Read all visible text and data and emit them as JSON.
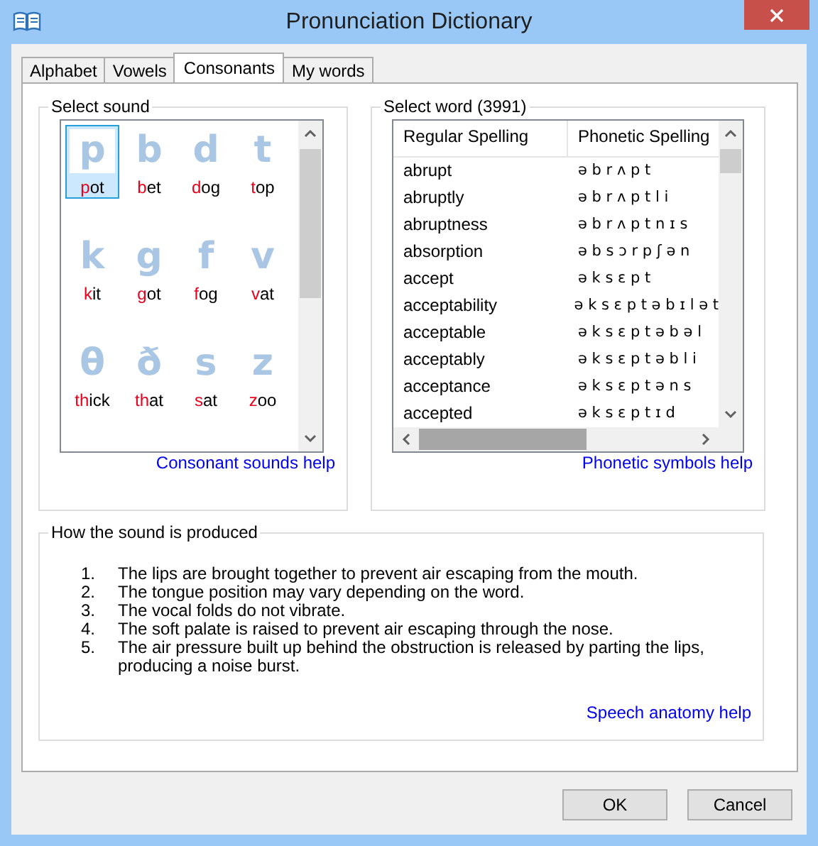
{
  "window": {
    "title": "Pronunciation Dictionary"
  },
  "tabs": [
    {
      "label": "Alphabet",
      "selected": false
    },
    {
      "label": "Vowels",
      "selected": false
    },
    {
      "label": "Consonants",
      "selected": true
    },
    {
      "label": "My words",
      "selected": false
    }
  ],
  "select_sound": {
    "title": "Select sound",
    "help_link": "Consonant sounds help",
    "sounds": [
      {
        "symbol": "p",
        "highlight": "p",
        "rest": "ot",
        "selected": true
      },
      {
        "symbol": "b",
        "highlight": "b",
        "rest": "et",
        "selected": false
      },
      {
        "symbol": "d",
        "highlight": "d",
        "rest": "og",
        "selected": false
      },
      {
        "symbol": "t",
        "highlight": "t",
        "rest": "op",
        "selected": false
      },
      {
        "symbol": "k",
        "highlight": "k",
        "rest": "it",
        "selected": false
      },
      {
        "symbol": "g",
        "highlight": "g",
        "rest": "ot",
        "selected": false
      },
      {
        "symbol": "f",
        "highlight": "f",
        "rest": "og",
        "selected": false
      },
      {
        "symbol": "v",
        "highlight": "v",
        "rest": "at",
        "selected": false
      },
      {
        "symbol": "θ",
        "highlight": "th",
        "rest": "ick",
        "selected": false
      },
      {
        "symbol": "ð",
        "highlight": "th",
        "rest": "at",
        "selected": false
      },
      {
        "symbol": "s",
        "highlight": "s",
        "rest": "at",
        "selected": false
      },
      {
        "symbol": "z",
        "highlight": "z",
        "rest": "oo",
        "selected": false
      }
    ]
  },
  "select_word": {
    "title": "Select word (3991)",
    "help_link": "Phonetic symbols help",
    "columns": [
      "Regular Spelling",
      "Phonetic Spelling"
    ],
    "rows": [
      [
        "abrupt",
        "ə b r ʌ p t"
      ],
      [
        "abruptly",
        "ə b r ʌ p t l i"
      ],
      [
        "abruptness",
        "ə b r ʌ p t n ɪ s"
      ],
      [
        "absorption",
        "ə b s ɔ r p ʃ ə n"
      ],
      [
        "accept",
        "ə k s ɛ p t"
      ],
      [
        "acceptability",
        "ə k s ɛ p t ə b ɪ l ə t"
      ],
      [
        "acceptable",
        "ə k s ɛ p t ə b ə l"
      ],
      [
        "acceptably",
        "ə k s ɛ p t ə b l i"
      ],
      [
        "acceptance",
        "ə k s ɛ p t ə n s"
      ],
      [
        "accepted",
        "ə k s ɛ p t ɪ d"
      ]
    ]
  },
  "production": {
    "title": "How the sound is produced",
    "help_link": "Speech anatomy help",
    "steps": [
      {
        "number": "1.",
        "text": "The lips are brought together to prevent air escaping from the mouth."
      },
      {
        "number": "2.",
        "text": "The tongue position may vary depending on the word."
      },
      {
        "number": "3.",
        "text": "The vocal folds do not vibrate."
      },
      {
        "number": "4.",
        "text": "The soft palate is raised to prevent air escaping through the nose."
      },
      {
        "number": "5.",
        "text": "The air pressure built up behind the obstruction is released by parting the lips, producing a noise burst."
      }
    ]
  },
  "buttons": [
    "OK",
    "Cancel"
  ]
}
